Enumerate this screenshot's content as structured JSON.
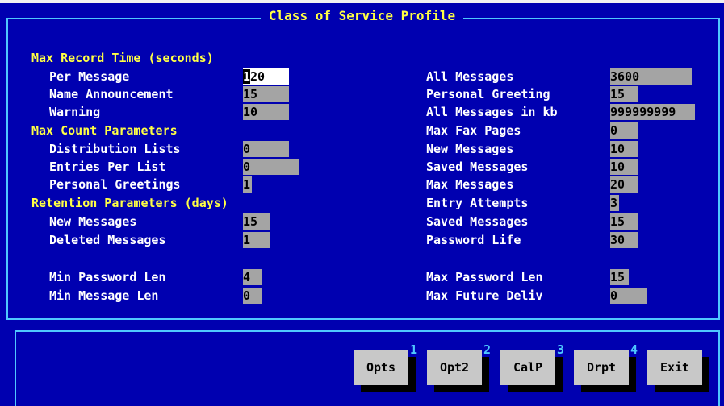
{
  "title": "Class of Service Profile",
  "left": {
    "max_record_header": "Max Record Time (seconds)",
    "per_message": {
      "label": "Per Message",
      "value": "120"
    },
    "name_announcement": {
      "label": "Name Announcement",
      "value": "15"
    },
    "warning": {
      "label": "Warning",
      "value": "10"
    },
    "max_count_header": "Max Count Parameters",
    "distribution_lists": {
      "label": "Distribution Lists",
      "value": "0"
    },
    "entries_per_list": {
      "label": "Entries Per List",
      "value": "0"
    },
    "personal_greetings": {
      "label": "Personal Greetings",
      "value": "1"
    },
    "retention_header": "Retention Parameters (days)",
    "new_messages": {
      "label": "New Messages",
      "value": "15"
    },
    "deleted_messages": {
      "label": "Deleted Messages",
      "value": "1"
    },
    "min_password_len": {
      "label": "Min Password Len",
      "value": "4"
    },
    "min_message_len": {
      "label": "Min Message Len",
      "value": "0"
    }
  },
  "right": {
    "all_messages": {
      "label": "All Messages",
      "value": "3600"
    },
    "personal_greeting": {
      "label": "Personal Greeting",
      "value": "15"
    },
    "all_messages_kb": {
      "label": "All Messages in kb",
      "value": "999999999"
    },
    "max_fax_pages": {
      "label": "Max Fax Pages",
      "value": "0"
    },
    "new_messages": {
      "label": "New Messages",
      "value": "10"
    },
    "saved_messages": {
      "label": "Saved Messages",
      "value": "10"
    },
    "max_messages": {
      "label": "Max Messages",
      "value": "20"
    },
    "entry_attempts": {
      "label": "Entry Attempts",
      "value": "3"
    },
    "saved_messages_days": {
      "label": "Saved Messages",
      "value": "15"
    },
    "password_life": {
      "label": "Password Life",
      "value": "30"
    },
    "max_password_len": {
      "label": "Max Password Len",
      "value": "15"
    },
    "max_future_deliv": {
      "label": "Max Future Deliv",
      "value": "0"
    }
  },
  "buttons": [
    {
      "label": "Opts",
      "hotkey": "1"
    },
    {
      "label": "Opt2",
      "hotkey": "2"
    },
    {
      "label": "CalP",
      "hotkey": "3"
    },
    {
      "label": "Drpt",
      "hotkey": "4"
    },
    {
      "label": "Exit",
      "hotkey": ""
    }
  ],
  "colors": {
    "background": "#0000b0",
    "border": "#4fc8ff",
    "header": "#ffff44",
    "field": "#a4a4a4"
  }
}
